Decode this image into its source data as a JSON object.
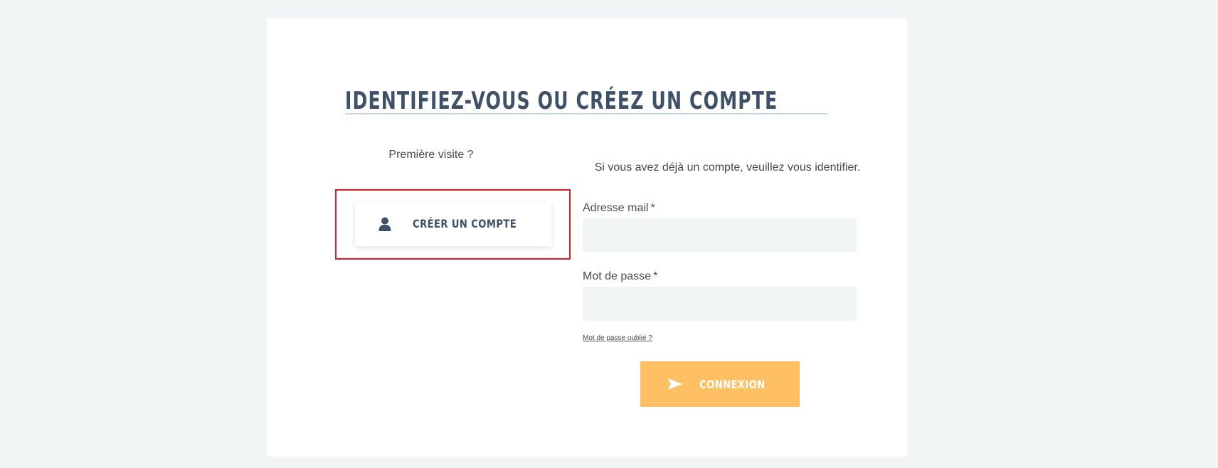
{
  "page": {
    "title": "IDENTIFIEZ-VOUS OU CRÉEZ UN COMPTE"
  },
  "new_account": {
    "intro": "Première visite ?",
    "button_label": "CRÉER UN COMPTE",
    "button_icon": "user-icon"
  },
  "login": {
    "intro": "Si vous avez déjà un compte, veuillez vous identifier.",
    "email_label": "Adresse mail",
    "email_value": "",
    "password_label": "Mot de passe",
    "password_value": "",
    "required_marker": "*",
    "forgot_link": "Mot de passe oublié ?",
    "submit_label": "CONNEXION",
    "submit_icon": "send-icon"
  },
  "colors": {
    "background": "#f1f5f5",
    "heading": "#3e5168",
    "accent": "#fec062",
    "highlight": "#d61f26"
  }
}
